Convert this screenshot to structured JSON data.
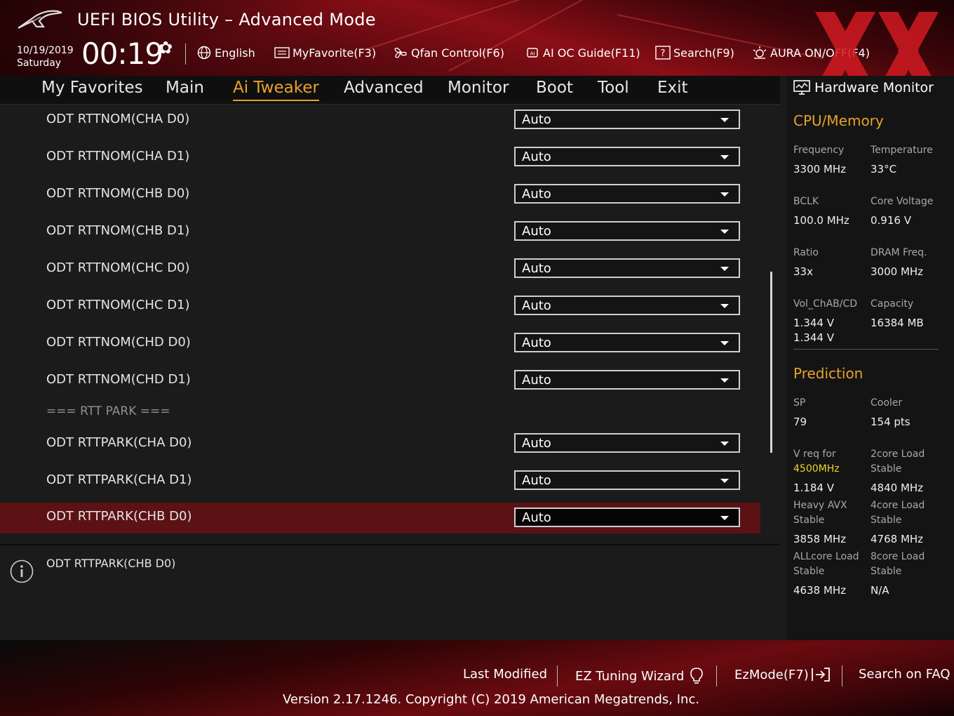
{
  "header": {
    "title": "UEFI BIOS Utility – Advanced Mode",
    "date": "10/19/2019",
    "day": "Saturday",
    "time": "00:19",
    "toolbar": [
      {
        "label": "English",
        "icon": "globe-icon"
      },
      {
        "label": "MyFavorite(F3)",
        "icon": "favorite-icon"
      },
      {
        "label": "Qfan Control(F6)",
        "icon": "fan-icon"
      },
      {
        "label": "AI OC Guide(F11)",
        "icon": "ai-chip-icon"
      },
      {
        "label": "Search(F9)",
        "icon": "search-help-icon"
      },
      {
        "label": "AURA ON/OFF(F4)",
        "icon": "aura-light-icon"
      }
    ]
  },
  "nav": {
    "tabs": [
      "My Favorites",
      "Main",
      "Ai Tweaker",
      "Advanced",
      "Monitor",
      "Boot",
      "Tool",
      "Exit"
    ],
    "active": "Ai Tweaker"
  },
  "settings": {
    "rows": [
      {
        "label": "ODT RTTNOM(CHA D0)",
        "value": "Auto"
      },
      {
        "label": "ODT RTTNOM(CHA D1)",
        "value": "Auto"
      },
      {
        "label": "ODT RTTNOM(CHB D0)",
        "value": "Auto"
      },
      {
        "label": "ODT RTTNOM(CHB D1)",
        "value": "Auto"
      },
      {
        "label": "ODT RTTNOM(CHC D0)",
        "value": "Auto"
      },
      {
        "label": "ODT RTTNOM(CHC D1)",
        "value": "Auto"
      },
      {
        "label": "ODT RTTNOM(CHD D0)",
        "value": "Auto"
      },
      {
        "label": "ODT RTTNOM(CHD D1)",
        "value": "Auto"
      }
    ],
    "section": "=== RTT PARK ===",
    "rows2": [
      {
        "label": "ODT RTTPARK(CHA D0)",
        "value": "Auto"
      },
      {
        "label": "ODT RTTPARK(CHA D1)",
        "value": "Auto"
      },
      {
        "label": "ODT RTTPARK(CHB D0)",
        "value": "Auto"
      }
    ],
    "selected_label": "ODT RTTPARK(CHB D0)"
  },
  "help": {
    "text": "ODT RTTPARK(CHB D0)"
  },
  "hw_monitor": {
    "title": "Hardware Monitor",
    "cpu_memory": {
      "heading": "CPU/Memory",
      "frequency_label": "Frequency",
      "frequency": "3300 MHz",
      "temperature_label": "Temperature",
      "temperature": "33°C",
      "bclk_label": "BCLK",
      "bclk": "100.0 MHz",
      "core_voltage_label": "Core Voltage",
      "core_voltage": "0.916 V",
      "ratio_label": "Ratio",
      "ratio": "33x",
      "dram_freq_label": "DRAM Freq.",
      "dram_freq": "3000 MHz",
      "vol_label": "Vol_ChAB/CD",
      "vol_ab": "1.344 V",
      "vol_cd": "1.344 V",
      "capacity_label": "Capacity",
      "capacity": "16384 MB"
    },
    "prediction": {
      "heading": "Prediction",
      "sp_label": "SP",
      "sp": "79",
      "cooler_label": "Cooler",
      "cooler": "154 pts",
      "vreq_label": "V req for",
      "vreq_freq": "4500MHz",
      "vreq": "1.184 V",
      "core2_label1": "2core Load",
      "core2_label2": "Stable",
      "core2": "4840 MHz",
      "avx_label1": "Heavy AVX",
      "avx_label2": "Stable",
      "avx": "3858 MHz",
      "core4_label1": "4core Load",
      "core4_label2": "Stable",
      "core4": "4768 MHz",
      "allcore_label1": "ALLcore Load",
      "allcore_label2": "Stable",
      "allcore": "4638 MHz",
      "core8_label1": "8core Load",
      "core8_label2": "Stable",
      "core8": "N/A"
    }
  },
  "footer": {
    "last_modified": "Last Modified",
    "ez_tuning": "EZ Tuning Wizard",
    "ezmode": "EzMode(F7)",
    "faq": "Search on FAQ",
    "version": "Version 2.17.1246. Copyright (C) 2019 American Megatrends, Inc."
  },
  "colors": {
    "accent": "#e8a22a",
    "selected_row": "#5c1214",
    "highlight": "#e8d52a"
  }
}
